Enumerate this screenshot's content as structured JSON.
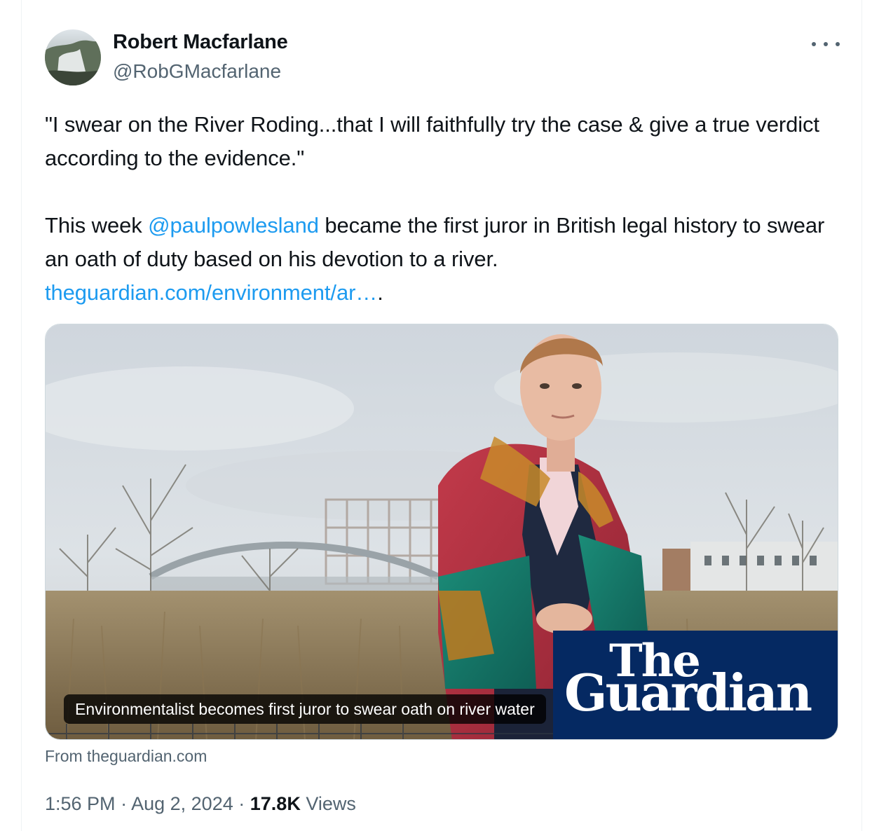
{
  "author": {
    "name": "Robert Macfarlane",
    "handle": "@RobGMacfarlane"
  },
  "tweet": {
    "line1": "\"I swear on the River Roding...that I will faithfully try the case & give a true verdict according to the evidence.\"",
    "line2_before": "This week ",
    "mention": "@paulpowlesland",
    "line2_after": " became the first juror in British legal history to swear an oath of duty based on his devotion to a river.",
    "url": "theguardian.com/environment/ar…",
    "url_suffix": "."
  },
  "card": {
    "caption": "Environmentalist becomes first juror to swear oath on river water",
    "brand_line1": "The",
    "brand_line2": "Guardian",
    "source": "From theguardian.com"
  },
  "meta": {
    "time": "1:56 PM",
    "date": "Aug 2, 2024",
    "views_count": "17.8K",
    "views_label": "Views",
    "separator": "·"
  },
  "icons": {
    "more": "more-horizontal-icon",
    "avatar": "profile-avatar"
  },
  "colors": {
    "link": "#1d9bf0",
    "secondary_text": "#536471",
    "guardian_blue": "#052962"
  }
}
